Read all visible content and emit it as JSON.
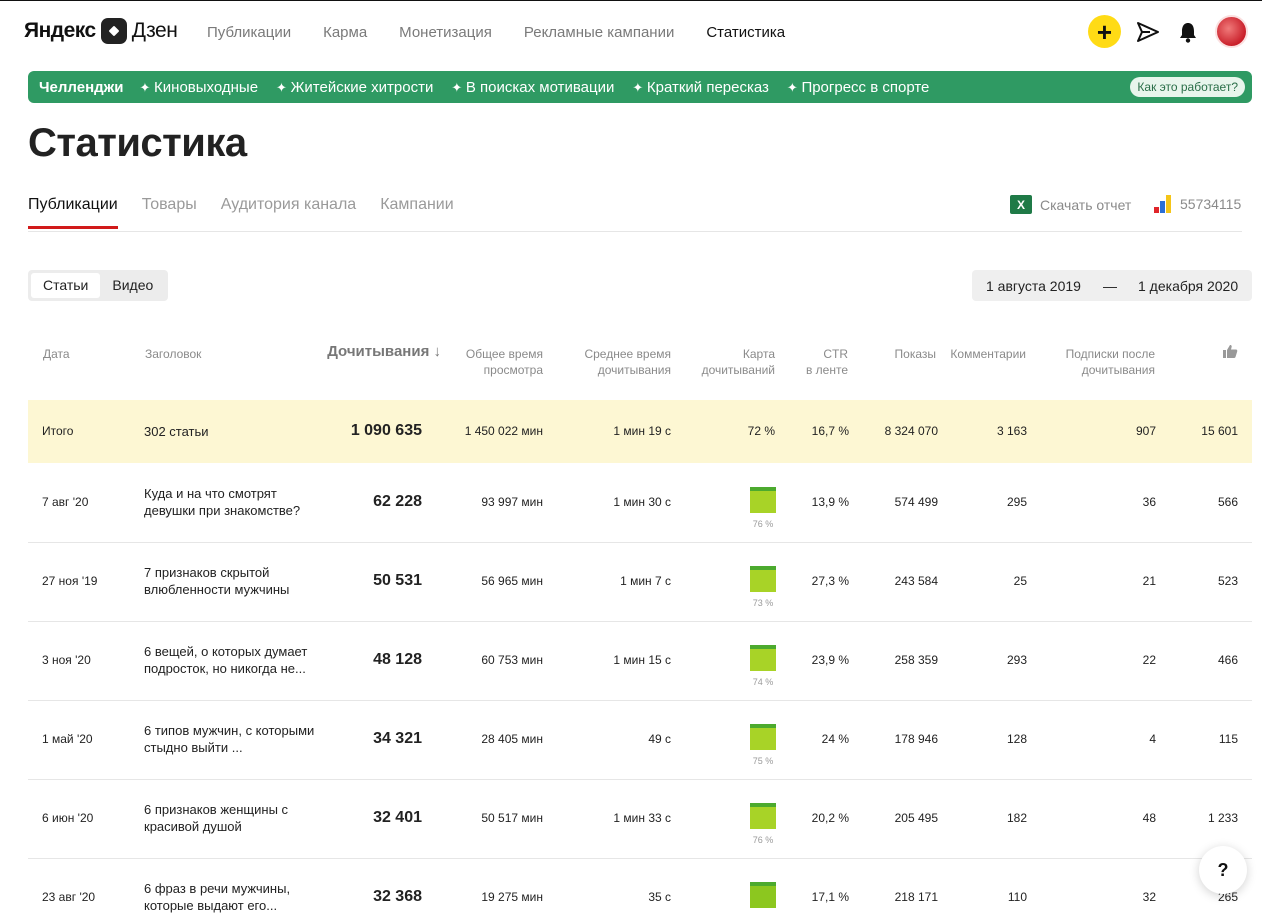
{
  "header": {
    "logo_a": "Яндекс",
    "logo_b": "Дзен",
    "nav": [
      {
        "label": "Публикации",
        "active": false
      },
      {
        "label": "Карма",
        "active": false
      },
      {
        "label": "Монетизация",
        "active": false
      },
      {
        "label": "Рекламные кампании",
        "active": false
      },
      {
        "label": "Статистика",
        "active": true
      }
    ]
  },
  "challenges": {
    "title": "Челленджи",
    "items": [
      "Киновыходные",
      "Житейские хитрости",
      "В поисках мотивации",
      "Краткий пересказ",
      "Прогресс в спорте"
    ],
    "how": "Как это работает?"
  },
  "page_title": "Статистика",
  "tabs": [
    {
      "label": "Публикации",
      "active": true
    },
    {
      "label": "Товары",
      "active": false
    },
    {
      "label": "Аудитория канала",
      "active": false
    },
    {
      "label": "Кампании",
      "active": false
    }
  ],
  "report": {
    "label": "Скачать отчет",
    "counter_id": "55734115"
  },
  "segment": [
    {
      "label": "Статьи",
      "active": true
    },
    {
      "label": "Видео",
      "active": false
    }
  ],
  "dates": {
    "from": "1 августа 2019",
    "dash": "—",
    "to": "1 декабря 2020"
  },
  "columns": {
    "date": "Дата",
    "title": "Заголовок",
    "reads": "Дочитывания ↓",
    "total_time_1": "Общее время",
    "total_time_2": "просмотра",
    "avg_time_1": "Среднее время",
    "avg_time_2": "дочитывания",
    "map_1": "Карта",
    "map_2": "дочитываний",
    "ctr_1": "CTR",
    "ctr_2": "в ленте",
    "shows": "Показы",
    "comments": "Комментарии",
    "subs_1": "Подписки после",
    "subs_2": "дочитывания",
    "likes_icon": "thumbs-up-icon"
  },
  "total": {
    "label": "Итого",
    "title": "302 статьи",
    "reads": "1 090 635",
    "total_time": "1 450 022 мин",
    "avg_time": "1 мин 19 с",
    "map": "72 %",
    "ctr": "16,7 %",
    "shows": "8 324 070",
    "comments": "3 163",
    "subs": "907",
    "likes": "15 601"
  },
  "rows": [
    {
      "date": "7 авг '20",
      "title": "Куда и на что смотрят девушки при знакомстве?",
      "reads": "62 228",
      "total_time": "93 997 мин",
      "avg_time": "1 мин 30 с",
      "map": "76 %",
      "ctr": "13,9 %",
      "shows": "574 499",
      "comments": "295",
      "subs": "36",
      "likes": "566"
    },
    {
      "date": "27 ноя '19",
      "title": "7 признаков скрытой влюбленности мужчины",
      "reads": "50 531",
      "total_time": "56 965 мин",
      "avg_time": "1 мин 7 с",
      "map": "73 %",
      "ctr": "27,3 %",
      "shows": "243 584",
      "comments": "25",
      "subs": "21",
      "likes": "523"
    },
    {
      "date": "3 ноя '20",
      "title": "6 вещей, о которых думает подросток, но никогда не...",
      "reads": "48 128",
      "total_time": "60 753 мин",
      "avg_time": "1 мин 15 с",
      "map": "74 %",
      "ctr": "23,9 %",
      "shows": "258 359",
      "comments": "293",
      "subs": "22",
      "likes": "466"
    },
    {
      "date": "1 май '20",
      "title": "6 типов мужчин, с которыми стыдно выйти ...",
      "reads": "34 321",
      "total_time": "28 405 мин",
      "avg_time": "49 с",
      "map": "75 %",
      "ctr": "24 %",
      "shows": "178 946",
      "comments": "128",
      "subs": "4",
      "likes": "115"
    },
    {
      "date": "6 июн '20",
      "title": "6 признаков женщины с красивой душой",
      "reads": "32 401",
      "total_time": "50 517 мин",
      "avg_time": "1 мин 33 с",
      "map": "76 %",
      "ctr": "20,2 %",
      "shows": "205 495",
      "comments": "182",
      "subs": "48",
      "likes": "1 233"
    },
    {
      "date": "23 авг '20",
      "title": "6 фраз в речи мужчины, которые выдают его...",
      "reads": "32 368",
      "total_time": "19 275 мин",
      "avg_time": "35 с",
      "map": "",
      "ctr": "17,1 %",
      "shows": "218 171",
      "comments": "110",
      "subs": "32",
      "likes": "265"
    }
  ],
  "help": "?"
}
